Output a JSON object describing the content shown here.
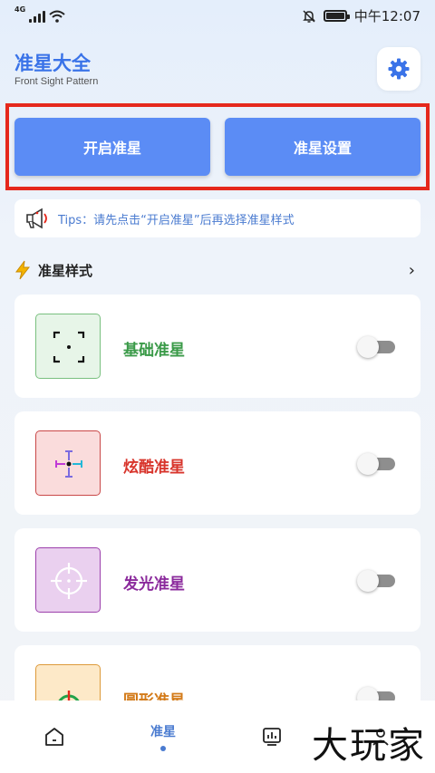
{
  "status_bar": {
    "network": "4G",
    "time": "中午12:07"
  },
  "header": {
    "title": "准星大全",
    "subtitle": "Front Sight Pattern",
    "settings_icon": "gear-icon"
  },
  "actions": {
    "start_label": "开启准星",
    "settings_label": "准星设置"
  },
  "tips": {
    "text": "Tips：请先点击“开启准星”后再选择准星样式"
  },
  "section": {
    "title": "准星样式",
    "more_icon": "chevron-right-icon"
  },
  "styles": [
    {
      "label": "基础准星",
      "color": "#3a9a48",
      "thumb_bg": "#e7f5e8",
      "thumb_border": "#79c07f",
      "enabled": false
    },
    {
      "label": "炫酷准星",
      "color": "#d8352c",
      "thumb_bg": "#fadcdc",
      "thumb_border": "#c94848",
      "enabled": false
    },
    {
      "label": "发光准星",
      "color": "#8b2a9c",
      "thumb_bg": "#ead0ef",
      "thumb_border": "#9c40ac",
      "enabled": false
    },
    {
      "label": "圆形准星",
      "color": "#d37a18",
      "thumb_bg": "#fde9c8",
      "thumb_border": "#dd9a3a",
      "enabled": false
    }
  ],
  "bottom_nav": {
    "items": [
      {
        "icon": "home-icon",
        "label": ""
      },
      {
        "icon": "",
        "label": "准星",
        "active": true
      },
      {
        "icon": "chart-icon",
        "label": ""
      },
      {
        "icon": "profile-icon",
        "label": ""
      }
    ]
  },
  "watermark": "大玩家"
}
